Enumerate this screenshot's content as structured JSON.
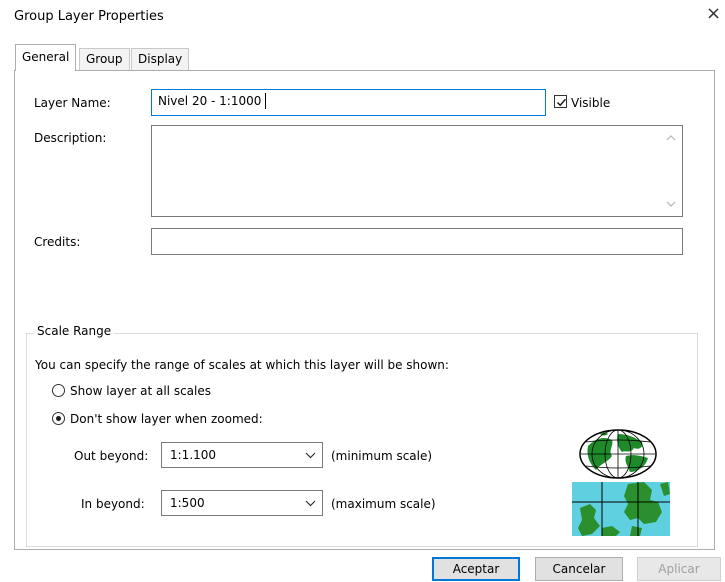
{
  "dialog": {
    "title": "Group Layer Properties",
    "close_glyph": "×"
  },
  "tabs": [
    {
      "label": "General",
      "active": true
    },
    {
      "label": "Group",
      "active": false
    },
    {
      "label": "Display",
      "active": false
    }
  ],
  "general": {
    "layer_name_label": "Layer Name:",
    "layer_name_value": "Nivel 20 - 1:1000",
    "visible_label": "Visible",
    "visible_checked": true,
    "description_label": "Description:",
    "description_value": "",
    "credits_label": "Credits:",
    "credits_value": ""
  },
  "scale_range": {
    "legend": "Scale Range",
    "intro": "You can specify the range of scales at which this layer will be shown:",
    "option_all": "Show layer at all scales",
    "option_zoomed": "Don't show layer when zoomed:",
    "selected_option": "zoomed",
    "out_beyond_label": "Out beyond:",
    "out_beyond_value": "1:1.100",
    "out_beyond_hint": "(minimum scale)",
    "in_beyond_label": "In beyond:",
    "in_beyond_value": "1:500",
    "in_beyond_hint": "(maximum scale)",
    "icons": [
      "globe-icon",
      "map-zoom-icon"
    ]
  },
  "buttons": {
    "ok": "Aceptar",
    "cancel": "Cancelar",
    "apply": "Aplicar"
  },
  "colors": {
    "focus_border": "#0078d7",
    "globe_land": "#1f8a2a",
    "map_sea": "#5fd0e0",
    "map_land": "#2c8f2e"
  }
}
